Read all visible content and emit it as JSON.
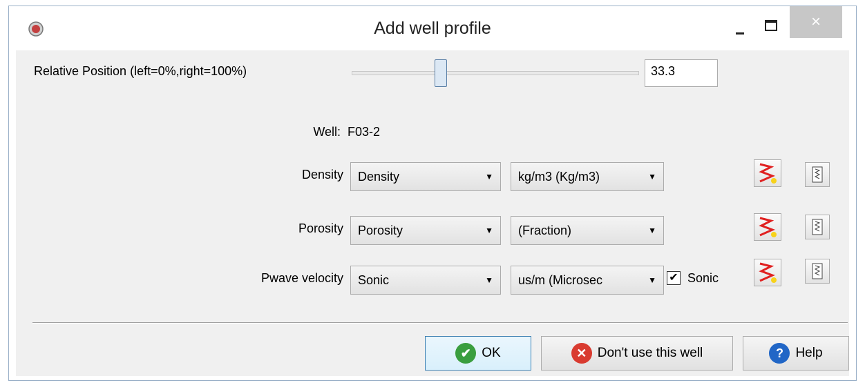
{
  "window": {
    "title": "Add well profile",
    "close_glyph": "×"
  },
  "position": {
    "label": "Relative Position (left=0%,right=100%)",
    "value": "33.3",
    "slider_percent": 33.3
  },
  "well": {
    "label": "Well:",
    "name": "F03-2"
  },
  "rows": [
    {
      "label": "Density",
      "log": "Density",
      "unit": "kg/m3 (Kg/m3)"
    },
    {
      "label": "Porosity",
      "log": "Porosity",
      "unit": "(Fraction)"
    },
    {
      "label": "Pwave velocity",
      "log": "Sonic",
      "unit": "us/m (Microsec"
    }
  ],
  "sonic_checkbox": {
    "label": "Sonic",
    "checked": true,
    "mark": "✔"
  },
  "buttons": {
    "ok": "OK",
    "dont_use": "Don't use this well",
    "help": "Help"
  },
  "icons": {
    "create_log": "create-log-icon",
    "log_tools": "log-tools-icon",
    "help_glyph": "?",
    "ok_glyph": "✔",
    "cancel_glyph": "✕"
  },
  "colors": {
    "ok_green": "#3a9e3f",
    "cancel_red": "#d93b30",
    "help_blue": "#2166c6",
    "accent": "#3c7fb1"
  }
}
